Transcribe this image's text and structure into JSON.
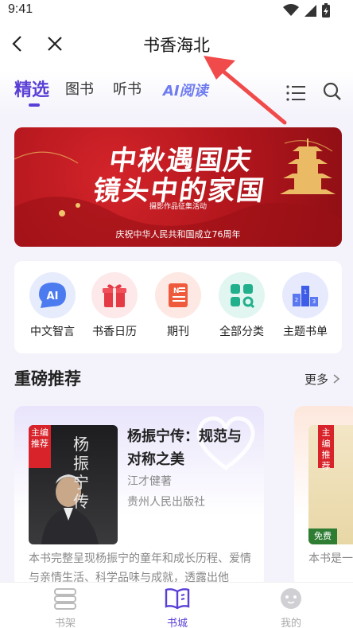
{
  "status": {
    "time": "9:41"
  },
  "header": {
    "title": "书香海北"
  },
  "tabs": [
    {
      "label": "精选",
      "active": true
    },
    {
      "label": "图书"
    },
    {
      "label": "听书"
    },
    {
      "label": "AI阅读"
    }
  ],
  "banner": {
    "line1": "中秋遇国庆",
    "line2": "镜头中的家国",
    "subtitle": "摄影作品征集活动",
    "footer": "庆祝中华人民共和国成立76周年"
  },
  "quick_entries": [
    {
      "label": "中文智言",
      "icon": "ai-icon",
      "icon_text": "AI"
    },
    {
      "label": "书香日历",
      "icon": "gift-calendar-icon"
    },
    {
      "label": "期刊",
      "icon": "journal-icon"
    },
    {
      "label": "全部分类",
      "icon": "category-grid-icon"
    },
    {
      "label": "主题书单",
      "icon": "ranking-podium-icon"
    }
  ],
  "section": {
    "title": "重磅推荐",
    "more": "更多"
  },
  "books": [
    {
      "badge": "主编推荐",
      "cover_text": "杨振宁传",
      "title": "杨振宁传：规范与对称之美",
      "author": "江才健著",
      "publisher": "贵州人民出版社",
      "description": "本书完整呈现杨振宁的童年和成长历程、爱情与亲情生活、科学品味与成就，透露出他"
    },
    {
      "badge": "主编推荐",
      "free_tag": "免费",
      "description": "本书是一的专著。"
    }
  ],
  "bottom_nav": [
    {
      "label": "书架",
      "icon": "bookshelf-icon"
    },
    {
      "label": "书城",
      "icon": "open-book-icon",
      "active": true
    },
    {
      "label": "我的",
      "icon": "profile-face-icon"
    }
  ],
  "colors": {
    "accent": "#5a3fd6",
    "banner_red": "#c41c22",
    "annotation_arrow": "#f04a4a"
  }
}
